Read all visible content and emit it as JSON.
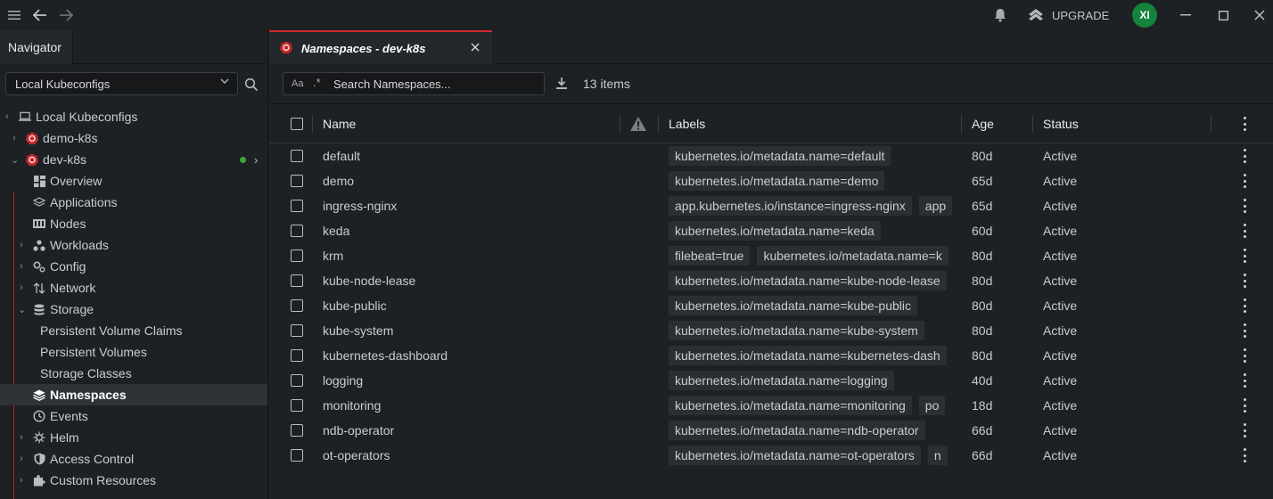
{
  "topbar": {
    "upgrade_label": "UPGRADE",
    "avatar_initials": "XI"
  },
  "navigator": {
    "title": "Navigator",
    "context_select": "Local Kubeconfigs",
    "tree": {
      "root": "Local Kubeconfigs",
      "clusters": [
        "demo-k8s",
        "dev-k8s"
      ],
      "items": [
        {
          "label": "Overview",
          "icon": "overview-icon"
        },
        {
          "label": "Applications",
          "icon": "applications-icon"
        },
        {
          "label": "Nodes",
          "icon": "nodes-icon"
        },
        {
          "label": "Workloads",
          "icon": "workloads-icon"
        },
        {
          "label": "Config",
          "icon": "config-icon"
        },
        {
          "label": "Network",
          "icon": "network-icon"
        },
        {
          "label": "Storage",
          "icon": "storage-icon"
        },
        {
          "label": "Persistent Volume Claims"
        },
        {
          "label": "Persistent Volumes"
        },
        {
          "label": "Storage Classes"
        },
        {
          "label": "Namespaces",
          "icon": "namespaces-icon"
        },
        {
          "label": "Events",
          "icon": "events-icon"
        },
        {
          "label": "Helm",
          "icon": "helm-icon"
        },
        {
          "label": "Access Control",
          "icon": "access-control-icon"
        },
        {
          "label": "Custom Resources",
          "icon": "custom-resources-icon"
        }
      ]
    }
  },
  "tab": {
    "label": "Namespaces - dev-k8s"
  },
  "toolbar": {
    "case_label": "Aa",
    "regex_label": ".*",
    "search_placeholder": "Search Namespaces...",
    "items_count": "13 items"
  },
  "table": {
    "columns": {
      "name": "Name",
      "labels": "Labels",
      "age": "Age",
      "status": "Status"
    },
    "rows": [
      {
        "name": "default",
        "labels": [
          "kubernetes.io/metadata.name=default"
        ],
        "age": "80d",
        "status": "Active"
      },
      {
        "name": "demo",
        "labels": [
          "kubernetes.io/metadata.name=demo"
        ],
        "age": "65d",
        "status": "Active"
      },
      {
        "name": "ingress-nginx",
        "labels": [
          "app.kubernetes.io/instance=ingress-nginx",
          "app"
        ],
        "age": "65d",
        "status": "Active"
      },
      {
        "name": "keda",
        "labels": [
          "kubernetes.io/metadata.name=keda"
        ],
        "age": "60d",
        "status": "Active"
      },
      {
        "name": "krm",
        "labels": [
          "filebeat=true",
          "kubernetes.io/metadata.name=k"
        ],
        "age": "80d",
        "status": "Active"
      },
      {
        "name": "kube-node-lease",
        "labels": [
          "kubernetes.io/metadata.name=kube-node-lease"
        ],
        "age": "80d",
        "status": "Active"
      },
      {
        "name": "kube-public",
        "labels": [
          "kubernetes.io/metadata.name=kube-public"
        ],
        "age": "80d",
        "status": "Active"
      },
      {
        "name": "kube-system",
        "labels": [
          "kubernetes.io/metadata.name=kube-system"
        ],
        "age": "80d",
        "status": "Active"
      },
      {
        "name": "kubernetes-dashboard",
        "labels": [
          "kubernetes.io/metadata.name=kubernetes-dash"
        ],
        "age": "80d",
        "status": "Active"
      },
      {
        "name": "logging",
        "labels": [
          "kubernetes.io/metadata.name=logging"
        ],
        "age": "40d",
        "status": "Active"
      },
      {
        "name": "monitoring",
        "labels": [
          "kubernetes.io/metadata.name=monitoring",
          "po"
        ],
        "age": "18d",
        "status": "Active"
      },
      {
        "name": "ndb-operator",
        "labels": [
          "kubernetes.io/metadata.name=ndb-operator"
        ],
        "age": "66d",
        "status": "Active"
      },
      {
        "name": "ot-operators",
        "labels": [
          "kubernetes.io/metadata.name=ot-operators",
          "n"
        ],
        "age": "66d",
        "status": "Active"
      }
    ]
  },
  "colors": {
    "accent_red": "#d3292f",
    "status_green": "#4caf50",
    "avatar_green": "#15833b"
  }
}
